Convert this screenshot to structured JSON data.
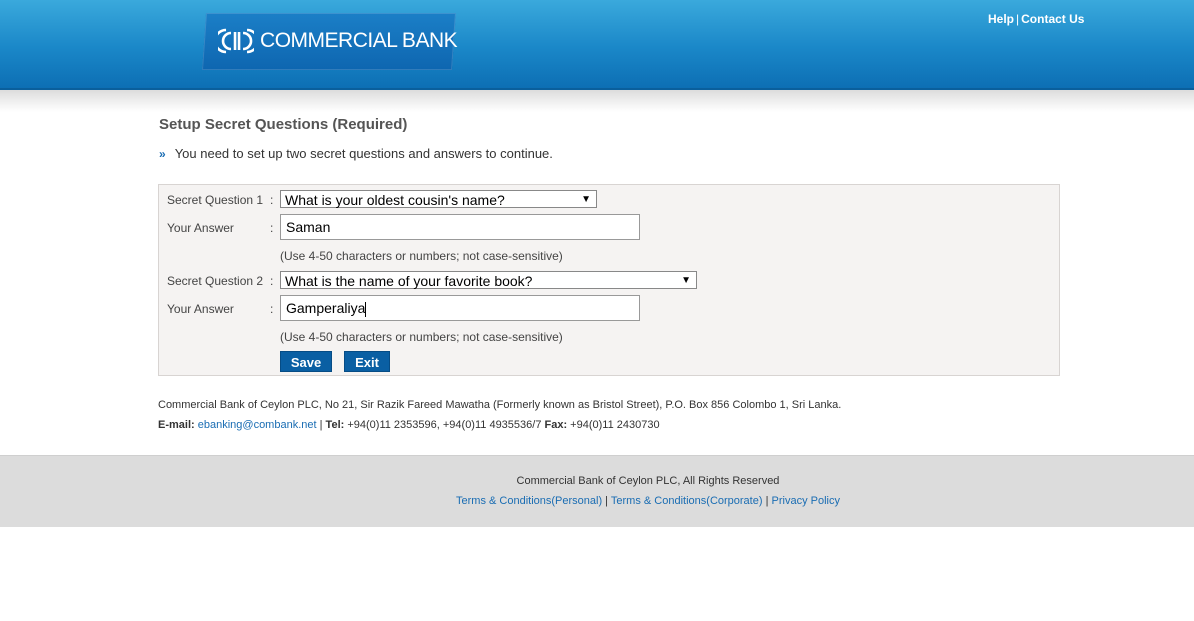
{
  "header": {
    "logo_text": "COMMERCIAL BANK",
    "help_link": "Help",
    "separator": "|",
    "contact_link": "Contact Us"
  },
  "main": {
    "title": "Setup Secret Questions (Required)",
    "notice_bullet": "»",
    "notice": "You need to set up two secret questions and answers to continue."
  },
  "form": {
    "colon": ":",
    "q1_label": "Secret Question 1",
    "q1_selected": "What is your oldest cousin's name?",
    "a1_label": "Your Answer",
    "a1_value": "Saman",
    "hint1": "(Use 4-50 characters or numbers; not case-sensitive)",
    "q2_label": "Secret Question 2",
    "q2_selected": "What is the name of your favorite book?",
    "a2_label": "Your Answer",
    "a2_value": "Gamperaliya",
    "hint2": "(Use 4-50 characters or numbers; not case-sensitive)",
    "save_label": "Save",
    "exit_label": "Exit",
    "dropdown_arrow": "▼"
  },
  "info": {
    "address": "Commercial Bank of Ceylon PLC, No 21, Sir Razik Fareed Mawatha (Formerly known as Bristol Street), P.O. Box 856 Colombo 1, Sri Lanka.",
    "email_label": "E-mail:",
    "email": "ebanking@combank.net",
    "sep": " | ",
    "tel_label": "Tel:",
    "tel": " +94(0)11 2353596, +94(0)11 4935536/7 ",
    "fax_label": "Fax:",
    "fax": " +94(0)11 2430730"
  },
  "footer": {
    "rights": "Commercial Bank of Ceylon PLC, All Rights Reserved",
    "terms_personal": "Terms & Conditions(Personal)",
    "terms_corporate": "Terms & Conditions(Corporate)",
    "privacy": "Privacy Policy",
    "sep": " | "
  },
  "colors": {
    "header_blue": "#1a87c8",
    "button_blue": "#0a5fa3",
    "link_blue": "#1a6db3",
    "footer_gray": "#dcdcdc"
  }
}
